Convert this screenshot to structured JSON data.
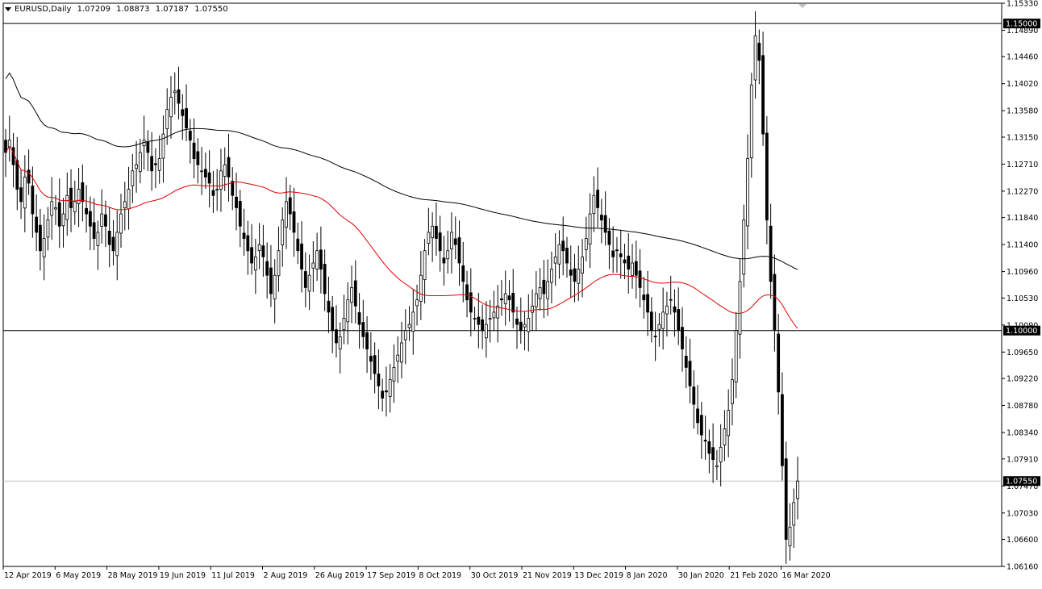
{
  "header": {
    "symbol": "EURUSD,Daily",
    "open": "1.07209",
    "high": "1.08873",
    "low": "1.07187",
    "close": "1.07550"
  },
  "colors": {
    "background": "#ffffff",
    "candle": "#000000",
    "ma_slow": "#000000",
    "ma_fast": "#e00000",
    "level_line": "#000000",
    "price_line": "#c0c0c0"
  },
  "chart_data": {
    "type": "candlestick",
    "symbol": "EURUSD",
    "timeframe": "Daily",
    "ylim": [
      1.0616,
      1.1533
    ],
    "y_ticks": [
      "1.15330",
      "1.14890",
      "1.14460",
      "1.14020",
      "1.13580",
      "1.13150",
      "1.12710",
      "1.12270",
      "1.11840",
      "1.11400",
      "1.10960",
      "1.10530",
      "1.10090",
      "1.09650",
      "1.09220",
      "1.08780",
      "1.08340",
      "1.07910",
      "1.07470",
      "1.07030",
      "1.06600",
      "1.06160"
    ],
    "x_labels": [
      "12 Apr 2019",
      "6 May 2019",
      "28 May 2019",
      "19 Jun 2019",
      "11 Jul 2019",
      "2 Aug 2019",
      "26 Aug 2019",
      "17 Sep 2019",
      "8 Oct 2019",
      "30 Oct 2019",
      "21 Nov 2019",
      "13 Dec 2019",
      "8 Jan 2020",
      "30 Jan 2020",
      "21 Feb 2020",
      "16 Mar 2020"
    ],
    "horizontal_levels": [
      {
        "value": 1.15,
        "label": "1.15000"
      },
      {
        "value": 1.1,
        "label": "1.10000"
      }
    ],
    "current_price": {
      "value": 1.0755,
      "label": "1.07550"
    },
    "closes": [
      1.129,
      1.131,
      1.127,
      1.123,
      1.121,
      1.125,
      1.124,
      1.119,
      1.116,
      1.113,
      1.115,
      1.118,
      1.121,
      1.12,
      1.117,
      1.119,
      1.122,
      1.12,
      1.121,
      1.123,
      1.121,
      1.119,
      1.117,
      1.115,
      1.116,
      1.119,
      1.117,
      1.114,
      1.113,
      1.116,
      1.119,
      1.121,
      1.123,
      1.126,
      1.127,
      1.129,
      1.131,
      1.129,
      1.126,
      1.127,
      1.128,
      1.132,
      1.136,
      1.138,
      1.139,
      1.137,
      1.135,
      1.133,
      1.131,
      1.128,
      1.127,
      1.126,
      1.125,
      1.124,
      1.122,
      1.123,
      1.126,
      1.127,
      1.125,
      1.122,
      1.12,
      1.117,
      1.115,
      1.113,
      1.111,
      1.112,
      1.114,
      1.112,
      1.109,
      1.106,
      1.109,
      1.113,
      1.118,
      1.121,
      1.119,
      1.116,
      1.113,
      1.11,
      1.107,
      1.109,
      1.111,
      1.113,
      1.11,
      1.106,
      1.103,
      1.1,
      1.098,
      1.099,
      1.102,
      1.105,
      1.107,
      1.104,
      1.101,
      1.099,
      1.097,
      1.095,
      1.093,
      1.091,
      1.089,
      1.09,
      1.092,
      1.094,
      1.096,
      1.098,
      1.1,
      1.101,
      1.103,
      1.105,
      1.109,
      1.113,
      1.116,
      1.117,
      1.115,
      1.113,
      1.111,
      1.113,
      1.116,
      1.114,
      1.111,
      1.108,
      1.105,
      1.103,
      1.102,
      1.101,
      1.1,
      1.101,
      1.102,
      1.103,
      1.104,
      1.105,
      1.106,
      1.105,
      1.103,
      1.101,
      1.1,
      1.101,
      1.102,
      1.104,
      1.106,
      1.107,
      1.106,
      1.108,
      1.11,
      1.112,
      1.114,
      1.113,
      1.111,
      1.109,
      1.108,
      1.11,
      1.112,
      1.115,
      1.119,
      1.122,
      1.12,
      1.118,
      1.116,
      1.114,
      1.112,
      1.113,
      1.112,
      1.111,
      1.11,
      1.111,
      1.109,
      1.107,
      1.105,
      1.103,
      1.1,
      1.099,
      1.101,
      1.103,
      1.104,
      1.105,
      1.103,
      1.1,
      1.097,
      1.094,
      1.091,
      1.088,
      1.085,
      1.083,
      1.082,
      1.08,
      1.079,
      1.078,
      1.081,
      1.084,
      1.087,
      1.092,
      1.1,
      1.108,
      1.118,
      1.128,
      1.14,
      1.148,
      1.144,
      1.132,
      1.118,
      1.108,
      1.1,
      1.09,
      1.078,
      1.066,
      1.068,
      1.072,
      1.0755
    ]
  }
}
